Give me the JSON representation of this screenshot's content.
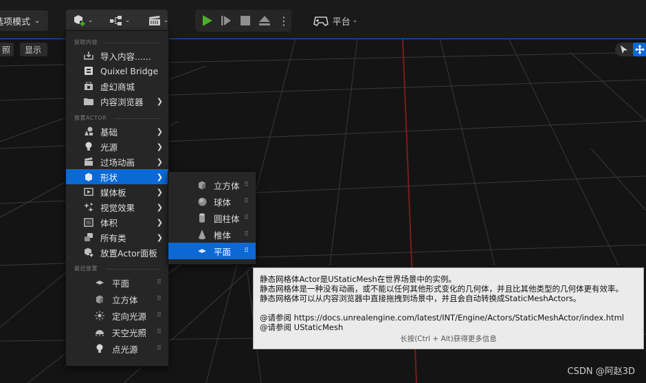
{
  "toolbar": {
    "mode_label": "选项模式",
    "platform_label": "平台"
  },
  "viewport_bar": {
    "lit_label": "照",
    "show_label": "显示"
  },
  "main_menu": {
    "section_get_content": "获取内容",
    "import": "导入内容......",
    "quixel": "Quixel Bridge",
    "marketplace": "虚幻商城",
    "content_browser": "内容浏览器",
    "section_place_actor": "放置ACTOR",
    "basic": "基础",
    "lights": "光源",
    "cinematic": "过场动画",
    "shapes": "形状",
    "media": "媒体板",
    "visual_effects": "视觉效果",
    "volumes": "体积",
    "all_classes": "所有类",
    "place_actor_panel": "放置Actor面板",
    "section_recent": "最近放置",
    "recent": [
      "平面",
      "立方体",
      "定向光源",
      "天空光照",
      "点光源"
    ]
  },
  "shapes_menu": {
    "items": [
      "立方体",
      "球体",
      "圆柱体",
      "椎体",
      "平面"
    ]
  },
  "tooltip": {
    "line1": "静态网格体Actor是UStaticMesh在世界场景中的实例。",
    "line2": "静态网格体是一种没有动画，或不能以任何其他形式变化的几何体，并且比其他类型的几何体更有效率。",
    "line3": "静态网格体可以从内容浏览器中直接拖拽到场景中，并且会自动转换成StaticMeshActors。",
    "line4": "@请参阅 https://docs.unrealengine.com/latest/INT/Engine/Actors/StaticMeshActor/index.html",
    "line5": "@请参阅 UStaticMesh",
    "hint": "长按(Ctrl + Alt)获得更多信息"
  },
  "watermark": "CSDN @阿赵3D",
  "colors": {
    "accent": "#0b69d6",
    "play_green": "#4caf2a",
    "axis_red": "#8a1f1f"
  }
}
